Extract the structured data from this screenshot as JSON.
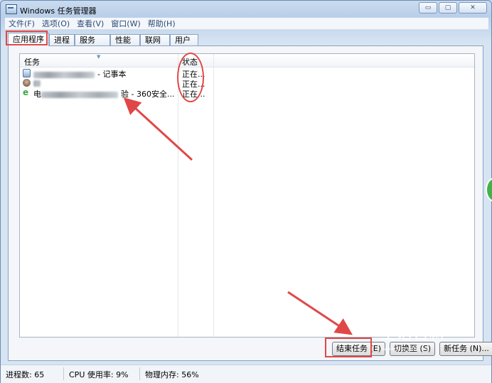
{
  "window": {
    "title": "Windows 任务管理器",
    "controls": {
      "minimize": "▭",
      "maximize": "▢",
      "close": "✕"
    }
  },
  "menu": [
    "文件(F)",
    "选项(O)",
    "查看(V)",
    "窗口(W)",
    "帮助(H)"
  ],
  "tabs": [
    "应用程序",
    "进程",
    "服务",
    "性能",
    "联网",
    "用户"
  ],
  "active_tab": "应用程序",
  "list": {
    "columns": {
      "task": "任务",
      "status": "状态"
    },
    "rows": [
      {
        "icon": "notepad-icon",
        "task_suffix": "- 记事本",
        "status": "正在..."
      },
      {
        "icon": "avatar-icon",
        "task_suffix": "",
        "status": "正在..."
      },
      {
        "icon": "ie-browser-icon",
        "task_prefix": "电",
        "task_suffix": "验 - 360安全...",
        "status": "正在..."
      }
    ]
  },
  "buttons": {
    "end_task": "结束任务 (E)",
    "switch_to": "切换至 (S)",
    "new_task": "新任务 (N)..."
  },
  "statusbar": {
    "processes": "进程数: 65",
    "cpu": "CPU 使用率: 9%",
    "memory": "物理内存: 56%"
  },
  "annotations": {
    "color": "#e04848"
  },
  "watermark": {
    "text": "生活百科",
    "sub": "www.bimeiz.com"
  }
}
